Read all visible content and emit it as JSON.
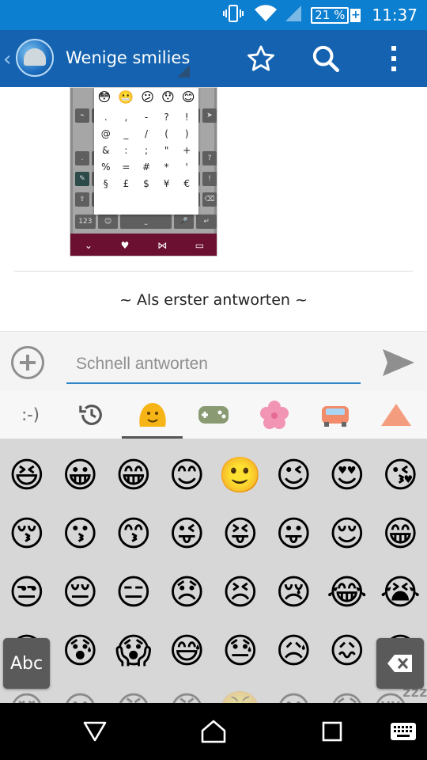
{
  "status_bar": {
    "battery_percent": "21 %",
    "time": "11:37",
    "icons": [
      "vibrate-icon",
      "wifi-icon",
      "signal-icon",
      "battery-charging-icon"
    ]
  },
  "app_bar": {
    "title": "Wenige smilies",
    "actions": [
      "star-icon",
      "search-icon",
      "more-vert-icon"
    ]
  },
  "attachment": {
    "emoji_row": [
      "😳",
      "😬",
      "😕",
      "😯",
      "😊"
    ],
    "symbols": [
      ".",
      ",",
      "-",
      "?",
      "!",
      "@",
      "_",
      "/",
      "(",
      ")",
      "&",
      ":",
      ";",
      "\"",
      "+",
      "%",
      "=",
      "#",
      "*",
      "'",
      "§",
      "£",
      "$",
      "¥",
      "€"
    ],
    "key_labels": [
      "123",
      "☺",
      "⎵",
      "🎤",
      "↵"
    ]
  },
  "thread": {
    "first_answer": "~ Als erster antworten ~"
  },
  "reply_bar": {
    "placeholder": "Schnell antworten"
  },
  "emoji_keyboard": {
    "categories": [
      {
        "name": "emoticon-text",
        "label": ":-)"
      },
      {
        "name": "recent-icon"
      },
      {
        "name": "smiley-face-icon",
        "active": true
      },
      {
        "name": "gamepad-icon"
      },
      {
        "name": "flower-icon"
      },
      {
        "name": "car-icon"
      },
      {
        "name": "symbols-triangle-icon"
      }
    ],
    "emoji": [
      "😆",
      "😀",
      "😁",
      "😊",
      "🙂",
      "😉",
      "😍",
      "😘",
      "😚",
      "😗",
      "😙",
      "😜",
      "😝",
      "😛",
      "😌",
      "😁",
      "😒",
      "😔",
      "😑",
      "😞",
      "😣",
      "😢",
      "😂",
      "😭",
      "😫",
      "😰",
      "😱",
      "😅",
      "😓",
      "😥",
      "😖",
      "😪",
      "😵",
      "😐",
      "😠",
      "😡",
      "😤",
      "😶",
      "😷",
      "😴"
    ],
    "abc_label": "Abc"
  },
  "nav_bar": [
    "back-icon",
    "home-icon",
    "recents-icon",
    "keyboard-icon"
  ],
  "colors": {
    "status_bar": "#0d7fd0",
    "app_bar": "#1563b0",
    "input_underline": "#2f87c8",
    "keyboard_bg": "#d7d7d7"
  }
}
